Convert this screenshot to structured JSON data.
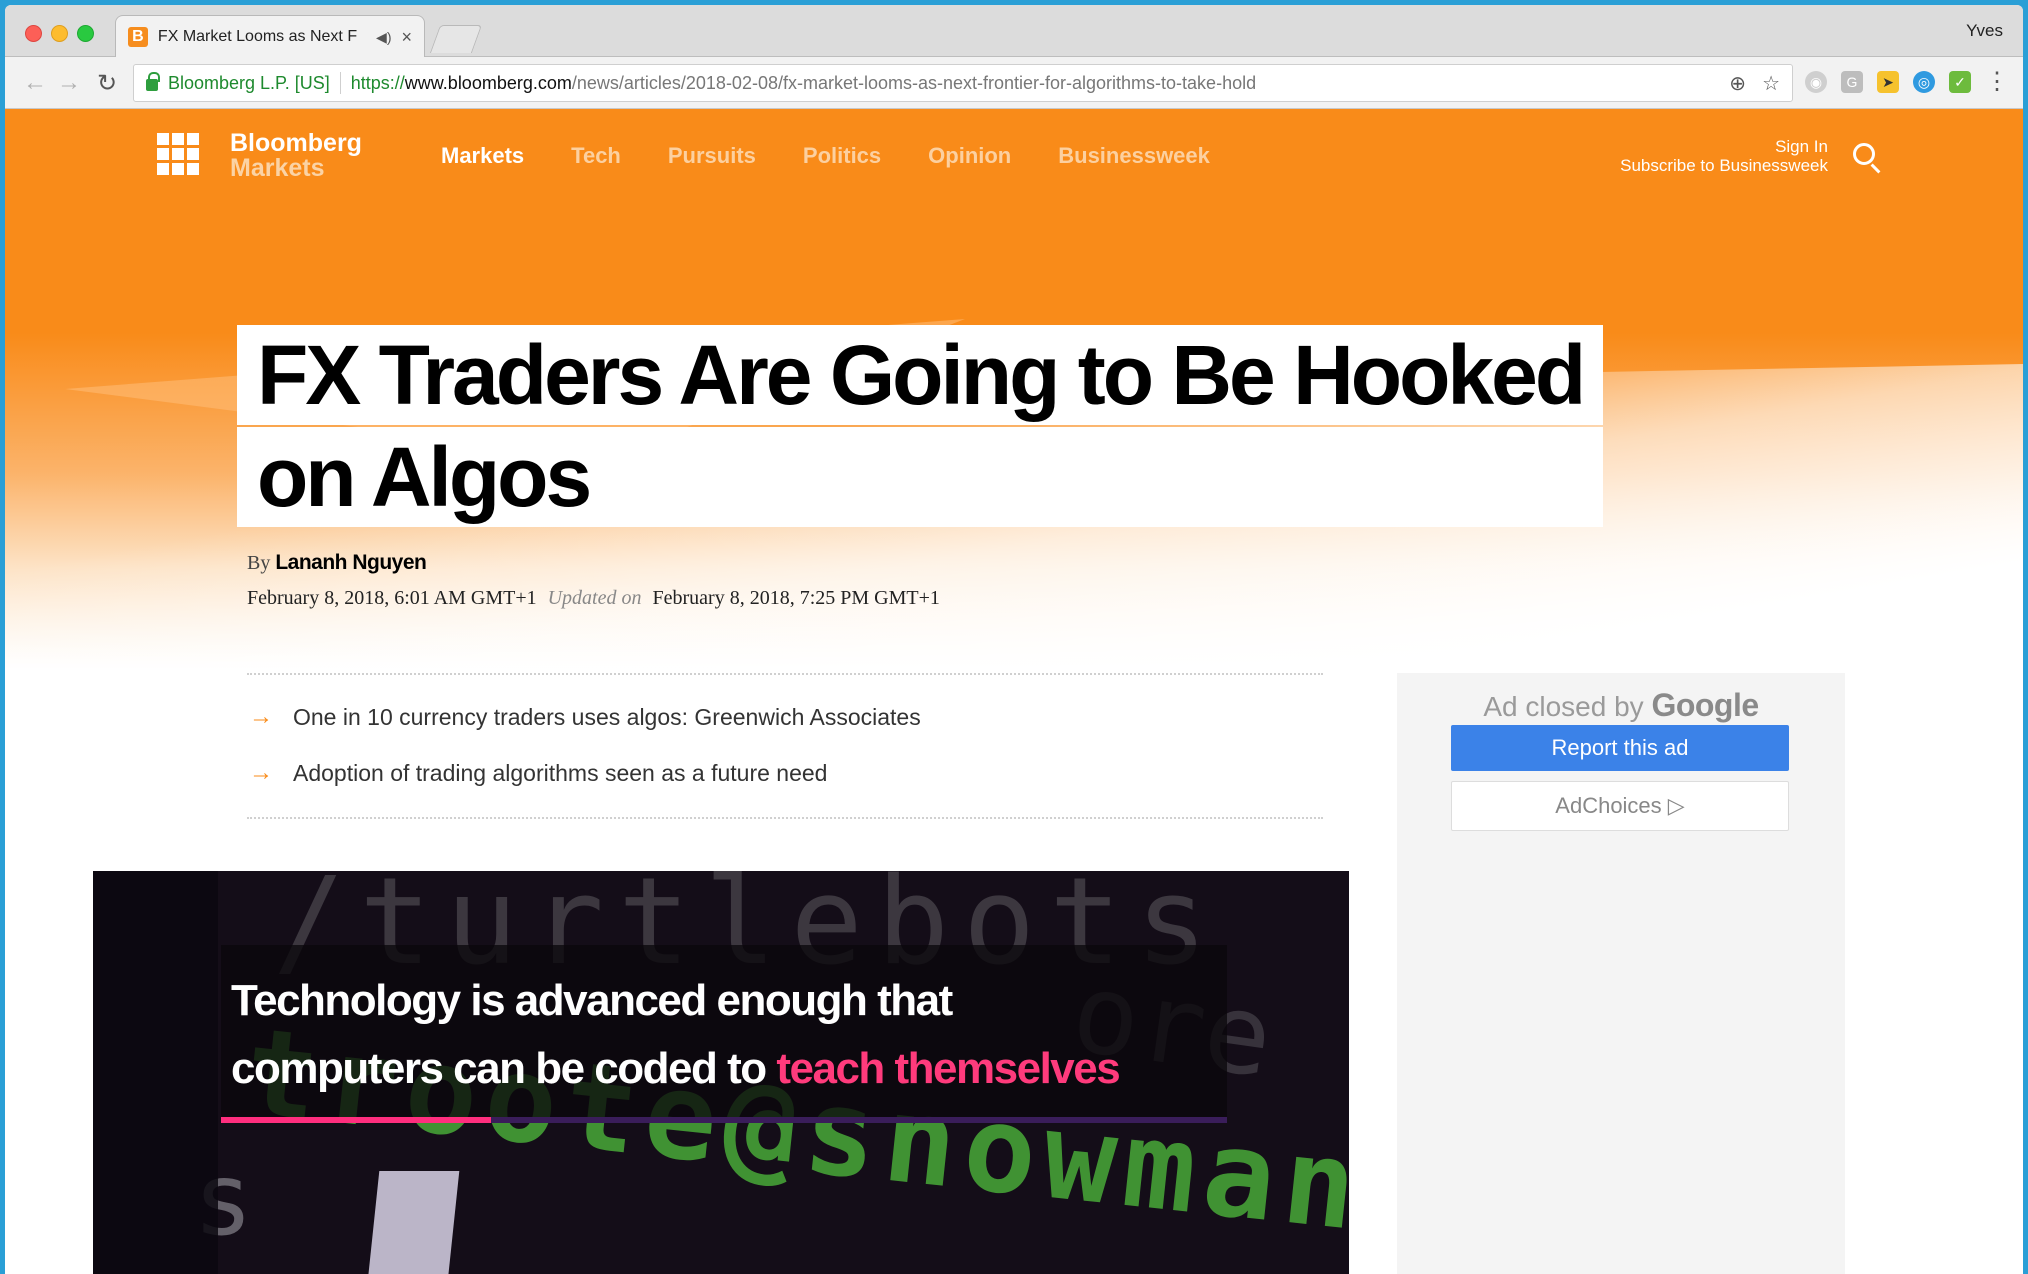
{
  "browser": {
    "tab": {
      "favicon": "B",
      "title": "FX Market Looms as Next F",
      "audio_icon": "speaker-icon",
      "close_icon": "close-icon"
    },
    "profile_name": "Yves",
    "address": {
      "site_identity": "Bloomberg L.P. [US]",
      "scheme": "https://",
      "host": "www.bloomberg.com",
      "path": "/news/articles/2018-02-08/fx-market-looms-as-next-frontier-for-algorithms-to-take-hold"
    }
  },
  "site": {
    "brand_line1": "Bloomberg",
    "brand_line2": "Markets",
    "nav": [
      "Markets",
      "Tech",
      "Pursuits",
      "Politics",
      "Opinion",
      "Businessweek"
    ],
    "sign_in": "Sign In",
    "subscribe": "Subscribe to Businessweek",
    "accent_color": "#f98b19"
  },
  "article": {
    "headline_line1": "FX Traders Are Going to Be Hooked",
    "headline_line2": "on Algos",
    "by_label": "By",
    "author": "Lananh Nguyen",
    "published": "February 8, 2018, 6:01 AM GMT+1",
    "updated_label": "Updated on",
    "updated": "February 8, 2018, 7:25 PM GMT+1",
    "summary": [
      "One in 10 currency traders uses algos: Greenwich Associates",
      "Adoption of trading algorithms seen as a future need"
    ],
    "video": {
      "caption_line1": "Technology is advanced enough that",
      "caption_line2_plain": "computers can be coded to ",
      "caption_line2_highlight": "teach themselves"
    }
  },
  "ad": {
    "closed_by": "Ad closed by",
    "closed_brand": "Google",
    "report": "Report this ad",
    "adchoices": "AdChoices ▷"
  }
}
